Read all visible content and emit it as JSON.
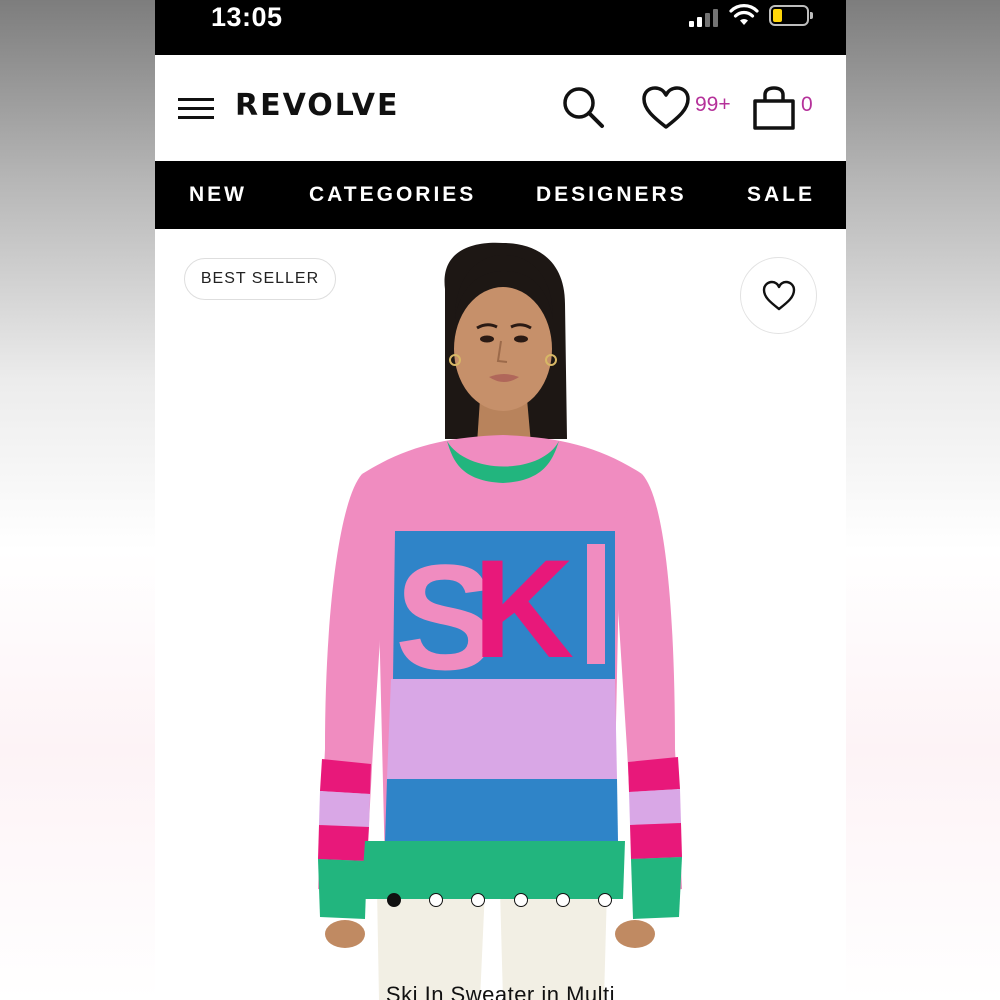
{
  "status_bar": {
    "time": "13:05"
  },
  "header": {
    "brand": "REVOLVE",
    "wishlist_count": "99+",
    "bag_count": "0",
    "icons": [
      "menu-icon",
      "search-icon",
      "heart-icon",
      "shopping-bag-icon"
    ]
  },
  "nav": {
    "items": [
      "NEW",
      "CATEGORIES",
      "DESIGNERS",
      "SALE"
    ]
  },
  "product": {
    "badge": "BEST SELLER",
    "image_text": "SKI",
    "title": "Ski In Sweater in Multi",
    "carousel": {
      "count": 6,
      "active": 1
    },
    "colors": {
      "pink": "#f08cc0",
      "green": "#22b57e",
      "blue": "#2f84c8",
      "hot_pink": "#e8187a",
      "lilac": "#d9a7e6"
    }
  }
}
